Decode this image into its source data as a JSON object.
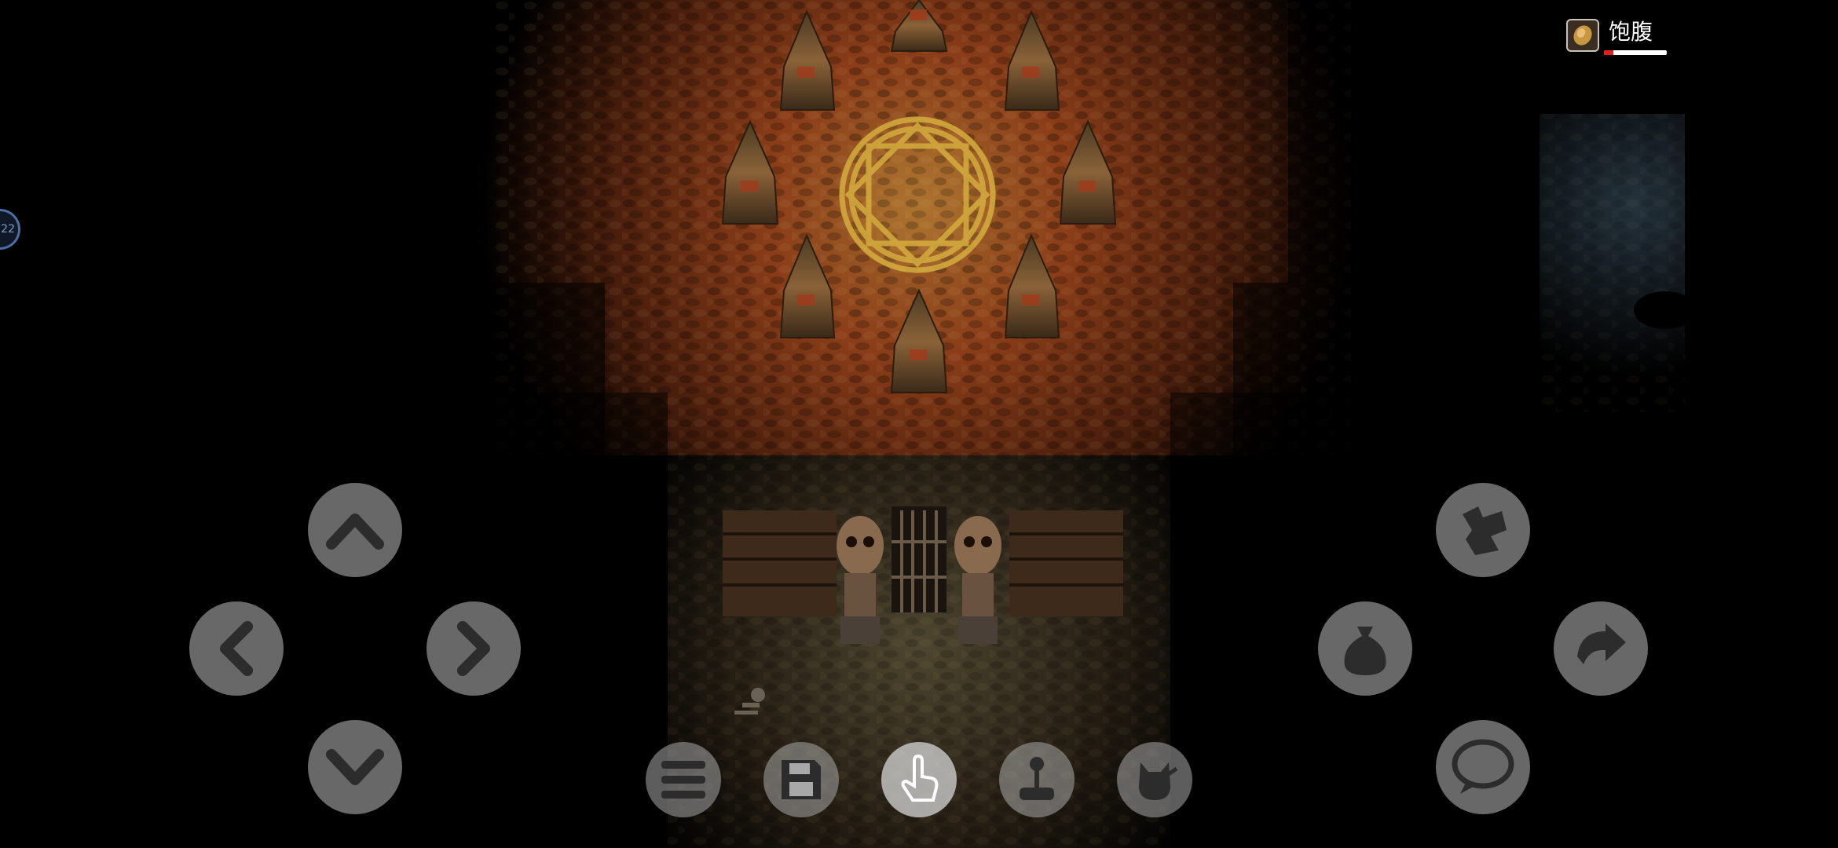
{
  "status": {
    "fullness_label": "饱腹",
    "fullness_icon": "bread-icon",
    "fullness_level": 0.15
  },
  "side_badge": {
    "text": "22"
  },
  "dpad": {
    "up_icon": "chevron-up-icon",
    "down_icon": "chevron-down-icon",
    "left_icon": "chevron-left-icon",
    "right_icon": "chevron-right-icon"
  },
  "actions": {
    "map_icon": "scroll-map-icon",
    "bag_icon": "sack-icon",
    "redo_icon": "curved-arrow-icon",
    "chat_icon": "speech-bubble-icon"
  },
  "menu": {
    "items": [
      "hamburger-menu-icon",
      "floppy-disk-icon",
      "pointing-hand-icon",
      "joystick-icon",
      "cat-silhouette-icon"
    ]
  },
  "colors": {
    "accent": "#e0b84a",
    "button_fill": "#bebebe",
    "fullness_low": "#e02020"
  }
}
